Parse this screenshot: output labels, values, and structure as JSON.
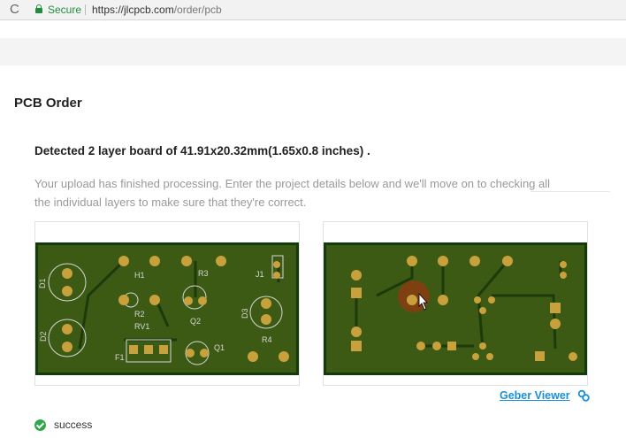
{
  "browser": {
    "reload_glyph": "C",
    "security_label": "Secure",
    "url_host": "https://jlcpcb.com",
    "url_path": "/order/pcb"
  },
  "page": {
    "title": "PCB Order",
    "detected_text": "Detected 2 layer board of 41.91x20.32mm(1.65x0.8 inches) .",
    "processing_text": "Your upload has finished processing. Enter the project details below and we'll move on to checking all the individual layers to make sure that they're correct.",
    "gerber_viewer_label": "Geber Viewer",
    "status_text": "success"
  },
  "pcb_top": {
    "labels": [
      "D1",
      "D2",
      "H1",
      "R2",
      "RV1",
      "R3",
      "Q2",
      "J1",
      "D3",
      "R4",
      "Q1",
      "F1"
    ]
  },
  "colors": {
    "secure_green": "#1e8e3e",
    "board_green": "#3c5a14",
    "board_edge": "#133a0a",
    "pad_gold": "#c9a13c",
    "link_blue": "#1a8fd8",
    "success_green": "#2ea84a"
  },
  "icons": {
    "reload": "reload-icon",
    "lock": "lock-icon",
    "link": "link-icon",
    "success": "check-circle-icon"
  }
}
